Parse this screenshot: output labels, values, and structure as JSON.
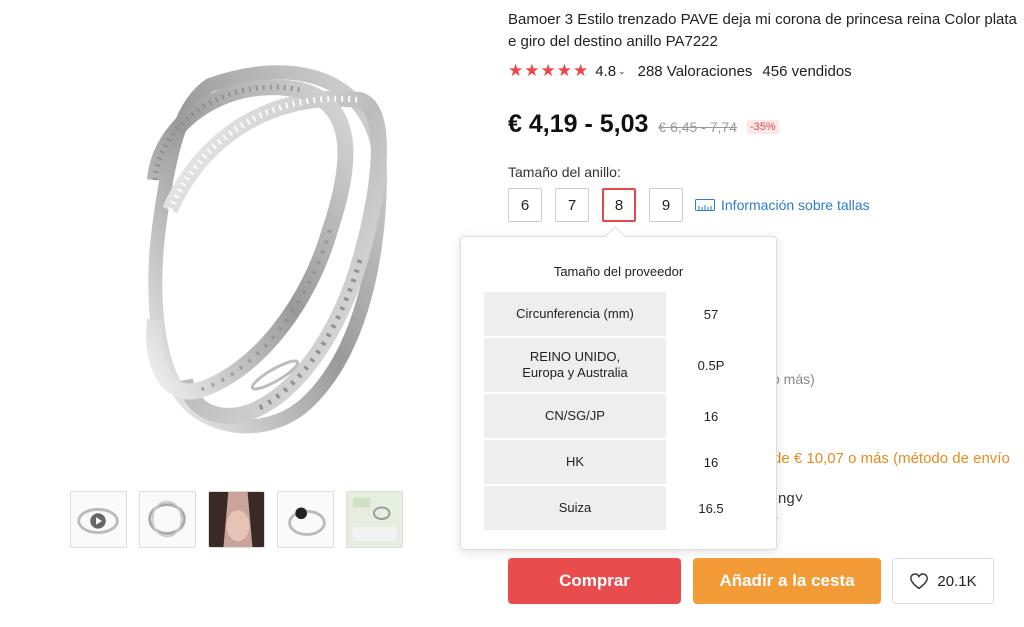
{
  "product": {
    "title_line1": "Bamoer 3 Estilo trenzado PAVE deja mi corona de princesa reina Color plata",
    "title_line2": "e giro del destino anillo PA7222",
    "stars": "★★★★★",
    "rating": "4.8",
    "reviews": "288 Valoraciones",
    "sold": "456 vendidos",
    "price": "€ 4,19 - 5,03",
    "old_price": "€ 6,45 - 7,74",
    "discount": "-35%"
  },
  "sizes": {
    "label": "Tamaño del anillo:",
    "options": [
      "6",
      "7",
      "8",
      "9"
    ],
    "selected": "8",
    "info_link": "Información sobre tallas"
  },
  "popover": {
    "title": "Tamaño del proveedor",
    "rows": [
      {
        "key": "Circunferencia (mm)",
        "value": "57"
      },
      {
        "key_line1": "REINO UNIDO,",
        "key_line2": "Europa y Australia",
        "value": "0.5P"
      },
      {
        "key": "CN/SG/JP",
        "value": "16"
      },
      {
        "key": "HK",
        "value": "16"
      },
      {
        "key": "Suiza",
        "value": "16.5"
      }
    ]
  },
  "background_fragments": {
    "more": "o más)",
    "shipping": "de € 10,07 o más (método de envío",
    "frag1": "ng˅",
    "frag2": "?"
  },
  "actions": {
    "buy": "Comprar",
    "cart": "Añadir a la cesta",
    "wishlist_count": "20.1K"
  },
  "colors": {
    "accent_red": "#e84c4c",
    "accent_orange": "#f29b37",
    "link_blue": "#2b7dcf"
  }
}
